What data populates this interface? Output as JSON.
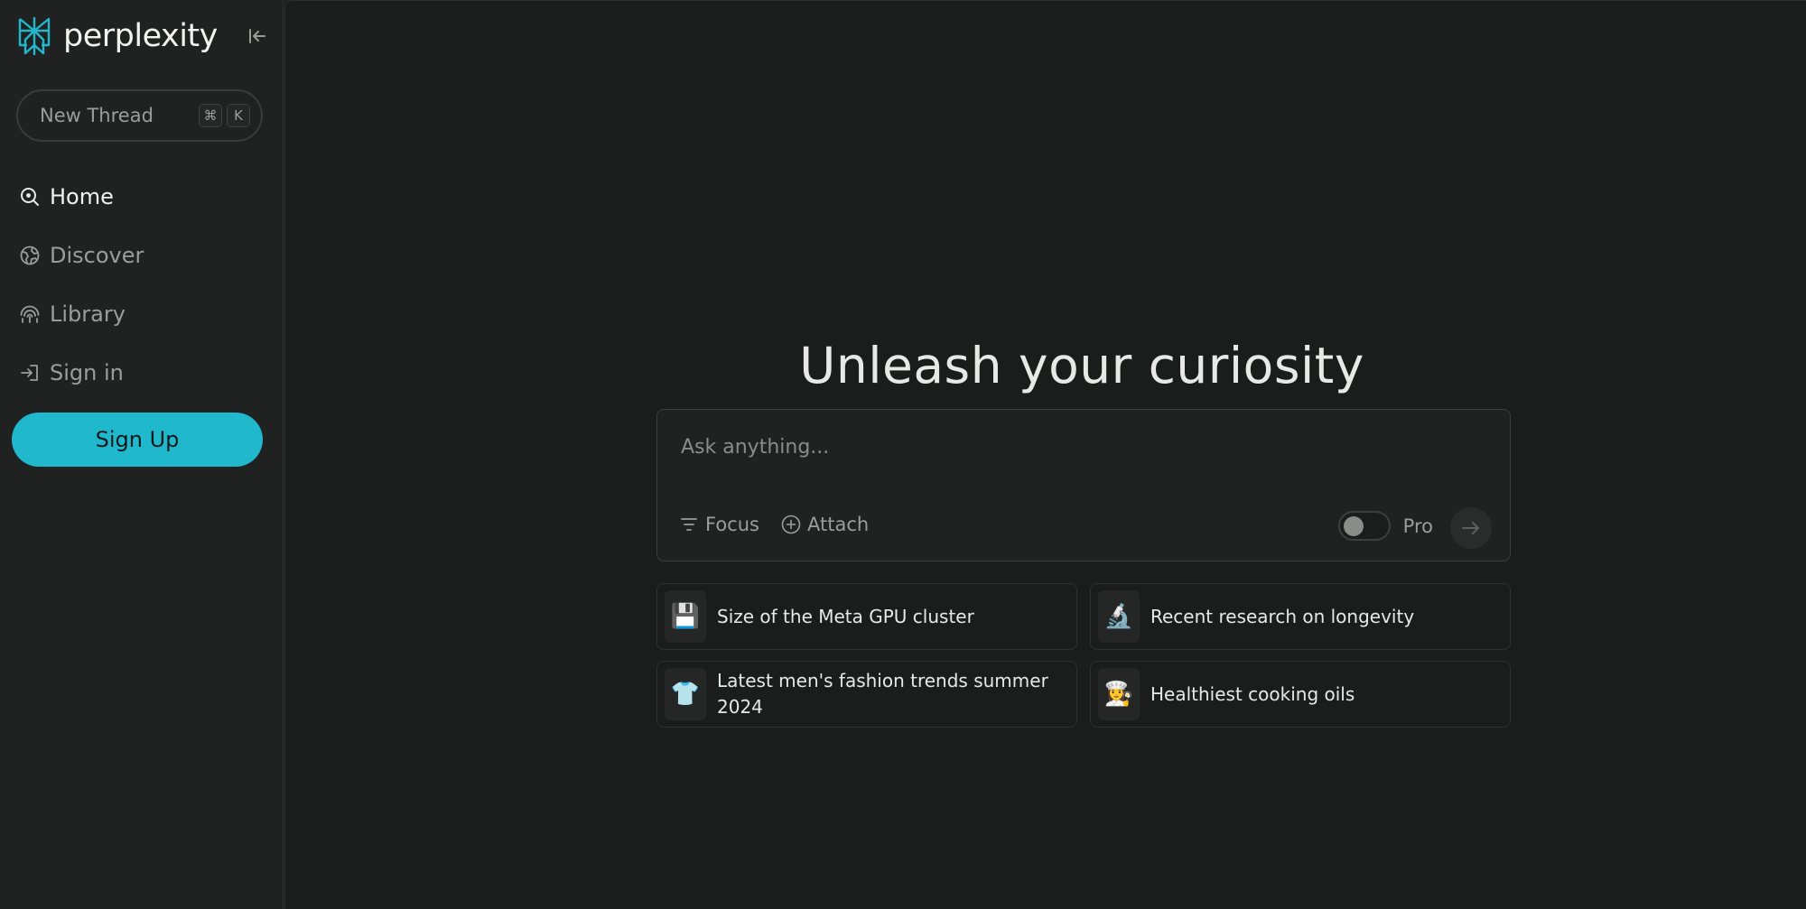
{
  "sidebar": {
    "brand": "perplexity",
    "new_thread": {
      "label": "New Thread",
      "shortcut_keys": [
        "⌘",
        "K"
      ]
    },
    "nav_items": [
      {
        "label": "Home",
        "icon": "search-icon",
        "active": true
      },
      {
        "label": "Discover",
        "icon": "globe-icon",
        "active": false
      },
      {
        "label": "Library",
        "icon": "library-icon",
        "active": false
      },
      {
        "label": "Sign in",
        "icon": "sign-in-icon",
        "active": false
      }
    ],
    "signup_label": "Sign Up"
  },
  "main": {
    "headline": "Unleash your curiosity",
    "ask": {
      "placeholder": "Ask anything...",
      "focus_label": "Focus",
      "attach_label": "Attach",
      "pro_label": "Pro",
      "pro_enabled": false
    },
    "suggestions": [
      {
        "emoji": "💾",
        "icon": "floppy-disk-icon",
        "text": "Size of the Meta GPU cluster"
      },
      {
        "emoji": "🔬",
        "icon": "microscope-icon",
        "text": "Recent research on longevity"
      },
      {
        "emoji": "👕",
        "icon": "t-shirt-icon",
        "text": "Latest men's fashion trends summer 2024"
      },
      {
        "emoji": "👩‍🍳",
        "icon": "chef-icon",
        "text": "Healthiest cooking oils"
      }
    ]
  },
  "colors": {
    "accent": "#20b8cd",
    "sidebar_bg": "#202222",
    "main_bg": "#1b1d1d",
    "text_primary": "#e8e8e6",
    "text_muted": "#9c9d9b"
  }
}
